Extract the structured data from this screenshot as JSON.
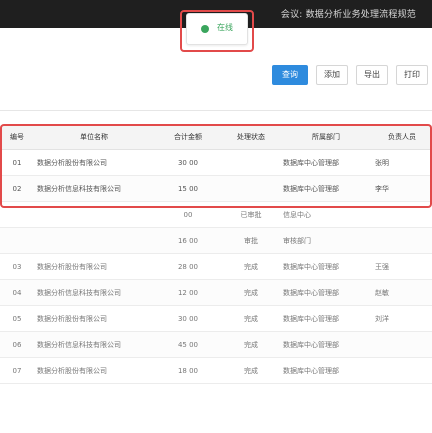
{
  "status_text": "会议: 数据分析业务处理流程规范",
  "tab": {
    "label": "在线"
  },
  "toolbar": {
    "buttons": [
      "查询",
      "添加",
      "导出",
      "打印"
    ]
  },
  "table": {
    "headers": [
      "编号",
      "单位名称",
      "合计金额",
      "处理状态",
      "所属部门",
      "负责人员"
    ],
    "rows": [
      [
        "01",
        "数据分析股份有限公司",
        "30 00",
        "",
        "数据库中心管理部",
        "张明"
      ],
      [
        "02",
        "数据分析信息科技有限公司",
        "15 00",
        "",
        "数据库中心管理部",
        "李华"
      ],
      [
        "",
        "",
        "00",
        "已审批",
        "信息中心",
        ""
      ],
      [
        "",
        "",
        "16 00",
        "审批",
        "审核部门",
        ""
      ],
      [
        "03",
        "数据分析股份有限公司",
        "28 00",
        "完成",
        "数据库中心管理部",
        "王强"
      ],
      [
        "04",
        "数据分析信息科技有限公司",
        "12 00",
        "完成",
        "数据库中心管理部",
        "赵敏"
      ],
      [
        "05",
        "数据分析股份有限公司",
        "30 00",
        "完成",
        "数据库中心管理部",
        "刘洋"
      ],
      [
        "06",
        "数据分析信息科技有限公司",
        "45 00",
        "完成",
        "数据库中心管理部",
        ""
      ],
      [
        "07",
        "数据分析股份有限公司",
        "18 00",
        "完成",
        "数据库中心管理部",
        ""
      ]
    ]
  },
  "colors": {
    "accent": "#2e8bde",
    "status_green": "#3aa55d",
    "highlight": "#e24a4a"
  }
}
